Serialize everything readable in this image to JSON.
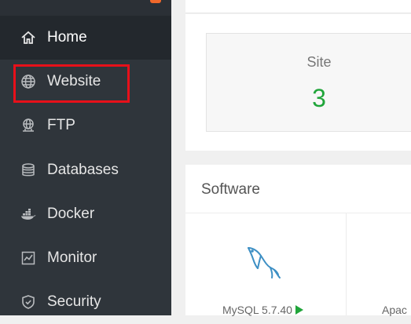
{
  "sidebar": {
    "items": [
      {
        "label": "Home",
        "icon": "home-icon",
        "active": true
      },
      {
        "label": "Website",
        "icon": "globe-icon",
        "active": false
      },
      {
        "label": "FTP",
        "icon": "ftp-icon",
        "active": false
      },
      {
        "label": "Databases",
        "icon": "database-icon",
        "active": false
      },
      {
        "label": "Docker",
        "icon": "docker-icon",
        "active": false
      },
      {
        "label": "Monitor",
        "icon": "monitor-icon",
        "active": false
      },
      {
        "label": "Security",
        "icon": "shield-icon",
        "active": false
      }
    ],
    "highlighted_item": "Website"
  },
  "overview": {
    "site_card": {
      "title": "Site",
      "count": "3"
    }
  },
  "software": {
    "title": "Software",
    "items": [
      {
        "name": "MySQL 5.7.40",
        "icon": "mysql-dolphin-icon"
      },
      {
        "name": "Apac"
      }
    ]
  },
  "colors": {
    "sidebar_bg": "#2f353b",
    "active_item_bg": "#23282d",
    "accent_green": "#20a53a",
    "highlight_red": "#e8101a",
    "mysql_blue": "#3d8fc4"
  }
}
